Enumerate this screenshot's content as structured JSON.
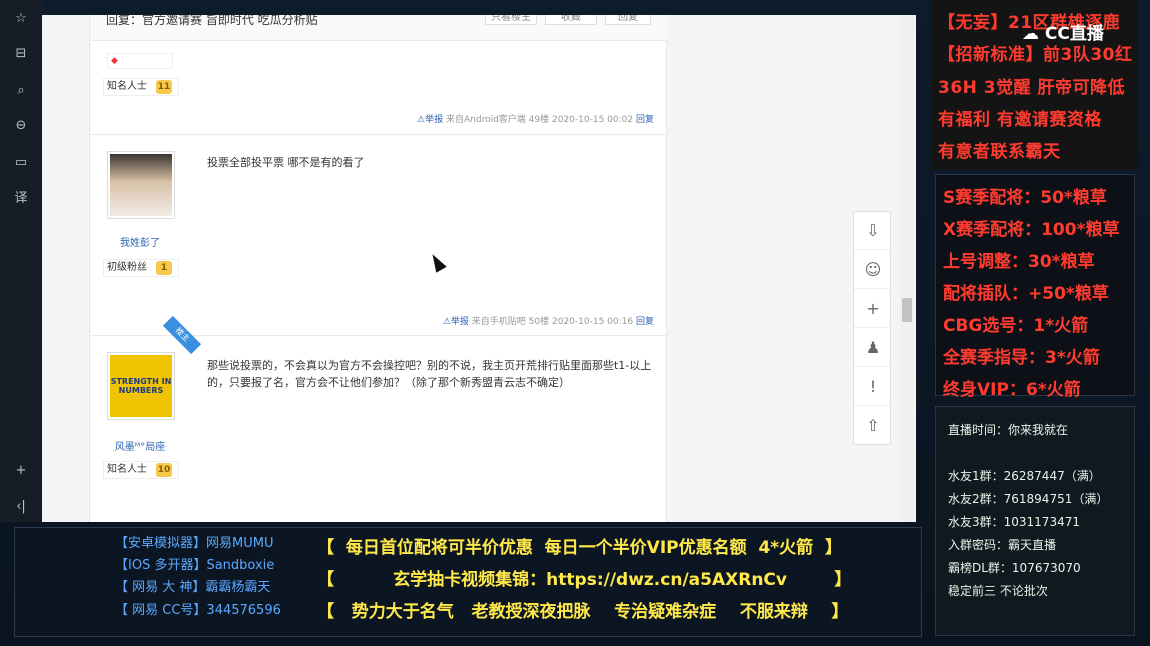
{
  "forum": {
    "reply_title": "回复：官方邀请赛 旨即时代 吃瓜分析贴",
    "top_buttons": [
      "只看楼主",
      "收藏",
      "回复"
    ],
    "posts": [
      {
        "avatar_desc": "",
        "username": "",
        "level_label": "知名人士",
        "level": "11",
        "text": "",
        "report": "举报",
        "source": "来自Android客户端",
        "floor": "49楼",
        "time": "2020-10-15 00:02",
        "reply": "回复"
      },
      {
        "username": "我姓彭了",
        "level_label": "初级粉丝",
        "level": "1",
        "text": "投票全部投平票 哪不是有的看了",
        "report": "举报",
        "source": "来自手机贴吧",
        "floor": "50楼",
        "time": "2020-10-15 00:16",
        "reply": "回复"
      },
      {
        "username": "风墨ᴹ°局座",
        "level_label": "知名人士",
        "level": "10",
        "corner_badge": "楼主",
        "avatar_text": "STRENGTH IN NUMBERS",
        "text": "那些说投票的，不会真以为官方不会操控吧？别的不说，我主页开荒排行贴里面那些t1-以上的，只要报了名，官方会不让他们参加？（除了那个新秀盟青云志不确定）"
      }
    ]
  },
  "overlay": {
    "logo": "CC直播",
    "promo_lines": [
      "【无妄】21区群雄逐鹿",
      "【招新标准】前3队30红",
      "36H 3觉醒 肝帝可降低",
      "有福利 有邀请赛资格",
      "有意者联系霸天"
    ],
    "price_lines": [
      "S赛季配将：50*粮草",
      "X赛季配将：100*粮草",
      "上号调整：30*粮草",
      "配将插队：+50*粮草",
      "CBG选号：1*火箭",
      "全赛季指导：3*火箭",
      "终身VIP：6*火箭"
    ],
    "info_lines": [
      "直播时间：你来我就在",
      "水友1群：26287447（满）",
      "水友2群：761894751（满）",
      "水友3群：1031173471",
      "入群密码：霸天直播",
      "霸榜DL群：107673070",
      "稳定前三      不论批次"
    ],
    "bottom_left": [
      "【安卓模拟器】网易MUMU",
      "【IOS 多开器】Sandboxie",
      "【 网易 大 神】霸霸杨霸天",
      "【 网易 CC号】344576596"
    ],
    "bottom_center": [
      "【  每日首位配将可半价优惠  每日一个半价VIP优惠名额  4*火箭  】",
      "【          玄学抽卡视频集锦：https://dwz.cn/a5AXRnCv        】",
      "【   势力大于名气   老教授深夜把脉    专治疑难杂症    不服来辩    】"
    ]
  },
  "colors": {
    "accent_red": "#ff3b2f",
    "link_blue": "#2d64b3",
    "banner_yellow": "#ffe94a"
  }
}
